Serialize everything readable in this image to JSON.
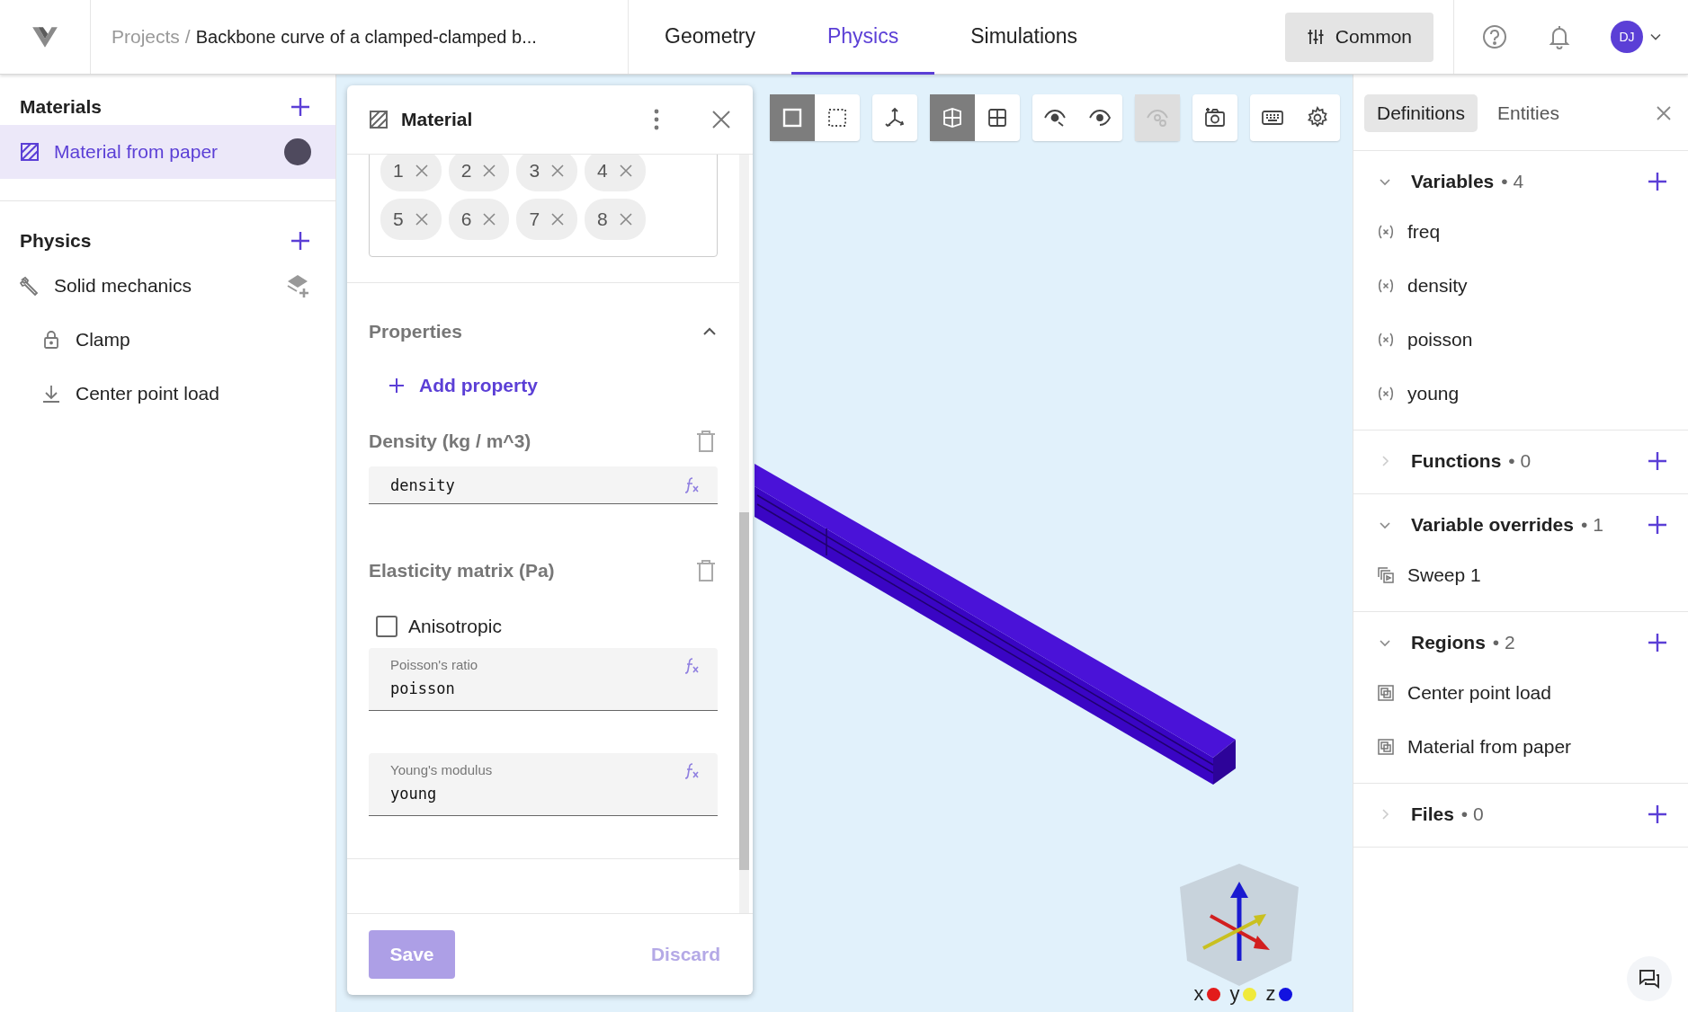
{
  "header": {
    "breadcrumb_root": "Projects",
    "breadcrumb_separator": "/",
    "breadcrumb_current": "Backbone curve of a clamped-clamped b...",
    "tabs": [
      {
        "label": "Geometry",
        "selected": false
      },
      {
        "label": "Physics",
        "selected": true
      },
      {
        "label": "Simulations",
        "selected": false
      }
    ],
    "common_button": "Common",
    "avatar": "DJ"
  },
  "sidebar": {
    "sections": [
      {
        "title": "Materials",
        "items": [
          {
            "label": "Material from paper",
            "kind": "material",
            "selected": true,
            "color": "#4f4a5e"
          }
        ]
      },
      {
        "title": "Physics",
        "items": [
          {
            "label": "Solid mechanics",
            "kind": "physics",
            "selected": false,
            "children": [
              {
                "label": "Clamp",
                "kind": "constraint",
                "selected": false
              },
              {
                "label": "Center point load",
                "kind": "load",
                "selected": false
              }
            ]
          }
        ]
      }
    ]
  },
  "toolbar": [
    {
      "buttons": [
        {
          "kind": "box-select",
          "selected": true,
          "disabled": false
        },
        {
          "kind": "dotted-select",
          "selected": false,
          "disabled": false
        }
      ]
    },
    {
      "buttons": [
        {
          "kind": "axes",
          "selected": false,
          "disabled": false
        }
      ]
    },
    {
      "buttons": [
        {
          "kind": "surface",
          "selected": true,
          "disabled": false
        },
        {
          "kind": "mesh",
          "selected": false,
          "disabled": false
        }
      ]
    },
    {
      "buttons": [
        {
          "kind": "eye-hide",
          "selected": false,
          "disabled": false
        },
        {
          "kind": "eye-show",
          "selected": false,
          "disabled": false
        }
      ]
    },
    {
      "buttons": [
        {
          "kind": "eye-settings",
          "selected": false,
          "disabled": true
        }
      ]
    },
    {
      "buttons": [
        {
          "kind": "camera",
          "selected": false,
          "disabled": false
        }
      ]
    },
    {
      "buttons": [
        {
          "kind": "keyboard",
          "selected": false,
          "disabled": false
        },
        {
          "kind": "settings",
          "selected": false,
          "disabled": false
        }
      ]
    }
  ],
  "material_panel": {
    "title": "Material",
    "chips": [
      "1",
      "2",
      "3",
      "4",
      "5",
      "6",
      "7",
      "8"
    ],
    "properties_title": "Properties",
    "properties_expanded": true,
    "add_property": "Add property",
    "density": {
      "label": "Density (kg / m^3)",
      "value": "density"
    },
    "elasticity": {
      "label": "Elasticity matrix (Pa)",
      "anisotropic": {
        "label": "Anisotropic",
        "checked": false
      },
      "fields": [
        {
          "label": "Poisson's ratio",
          "value": "poisson"
        },
        {
          "label": "Young's modulus",
          "value": "young"
        }
      ]
    },
    "save": {
      "label": "Save",
      "disabled": true
    },
    "discard": {
      "label": "Discard",
      "disabled": true
    }
  },
  "axes_legend": [
    {
      "label": "x",
      "color": "#e21b1b"
    },
    {
      "label": "y",
      "color": "#f0ea3c"
    },
    {
      "label": "z",
      "color": "#1212e0"
    }
  ],
  "definitions_panel": {
    "tabs": [
      {
        "label": "Definitions",
        "selected": true
      },
      {
        "label": "Entities",
        "selected": false
      }
    ],
    "sections": [
      {
        "title": "Variables",
        "count": "• 4",
        "expanded": true,
        "items": [
          {
            "label": "freq",
            "kind": "variable"
          },
          {
            "label": "density",
            "kind": "variable"
          },
          {
            "label": "poisson",
            "kind": "variable"
          },
          {
            "label": "young",
            "kind": "variable"
          }
        ]
      },
      {
        "title": "Functions",
        "count": "• 0",
        "expanded": false
      },
      {
        "title": "Variable overrides",
        "count": "• 1",
        "expanded": true,
        "items": [
          {
            "label": "Sweep 1",
            "kind": "sweep"
          }
        ]
      },
      {
        "title": "Regions",
        "count": "• 2",
        "expanded": true,
        "items": [
          {
            "label": "Center point load",
            "kind": "region"
          },
          {
            "label": "Material from paper",
            "kind": "region"
          }
        ]
      },
      {
        "title": "Files",
        "count": "• 0",
        "expanded": false
      }
    ]
  }
}
